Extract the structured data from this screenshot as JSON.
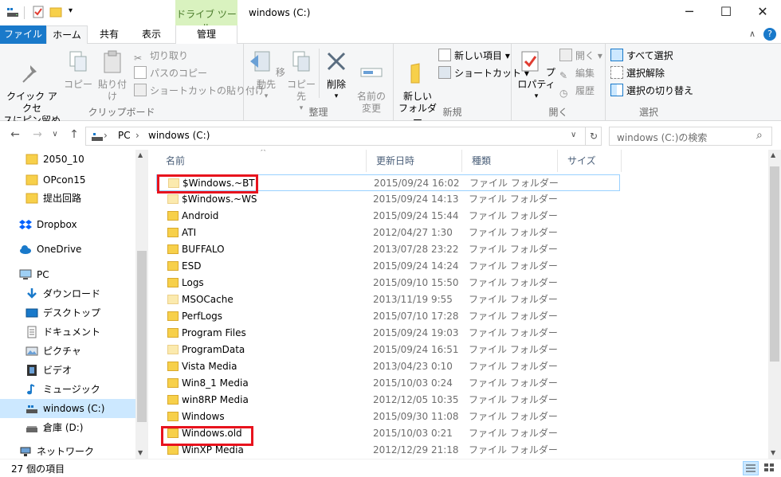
{
  "titlebar": {
    "context_tab": "ドライブ ツール",
    "title": "windows (C:)",
    "minimize": "─",
    "maximize": "☐",
    "close": "✕"
  },
  "tabs": {
    "file": "ファイル",
    "home": "ホーム",
    "share": "共有",
    "view": "表示",
    "manage": "管理",
    "collapse": "∧",
    "help": "?"
  },
  "ribbon": {
    "clipboard": {
      "label": "クリップボード",
      "pin": "クイック アクセ\nスにピン留め",
      "copy": "コピー",
      "paste": "貼り付け",
      "cut": "切り取り",
      "copy_path": "パスのコピー",
      "paste_shortcut": "ショートカットの貼り付け"
    },
    "organize": {
      "label": "整理",
      "move_to": "移動先",
      "copy_to": "コピー先",
      "delete": "削除",
      "rename": "名前の\n変更"
    },
    "new": {
      "label": "新規",
      "new_folder": "新しい\nフォルダー",
      "new_item": "新しい項目 ▾",
      "shortcut": "ショートカット ▾"
    },
    "open": {
      "label": "開く",
      "properties": "プロパティ",
      "open": "開く ▾",
      "edit": "編集",
      "history": "履歴"
    },
    "select": {
      "label": "選択",
      "select_all": "すべて選択",
      "select_none": "選択解除",
      "invert": "選択の切り替え"
    }
  },
  "address": {
    "back": "←",
    "forward": "→",
    "history": "∨",
    "up": "↑",
    "crumb_pc": "PC",
    "sep1": "›",
    "crumb_drive": "windows (C:)",
    "sep2": "›",
    "dropdown": "∨",
    "refresh": "↻",
    "search_placeholder": "windows (C:)の検索",
    "search_icon": "⌕"
  },
  "nav": {
    "items": [
      {
        "label": "2050_10"
      },
      {
        "label": "OPcon15"
      },
      {
        "label": "提出回路"
      },
      {
        "label": "Dropbox"
      },
      {
        "label": "OneDrive"
      },
      {
        "label": "PC"
      },
      {
        "label": "ダウンロード"
      },
      {
        "label": "デスクトップ"
      },
      {
        "label": "ドキュメント"
      },
      {
        "label": "ピクチャ"
      },
      {
        "label": "ビデオ"
      },
      {
        "label": "ミュージック"
      },
      {
        "label": "windows (C:)"
      },
      {
        "label": "倉庫 (D:)"
      },
      {
        "label": "ネットワーク"
      }
    ]
  },
  "filelist": {
    "sort_arrow": "^",
    "columns": {
      "name": "名前",
      "date": "更新日時",
      "type": "種類",
      "size": "サイズ"
    },
    "rows": [
      {
        "name": "$Windows.~BT",
        "date": "2015/09/24 16:02",
        "type": "ファイル フォルダー"
      },
      {
        "name": "$Windows.~WS",
        "date": "2015/09/24 14:13",
        "type": "ファイル フォルダー"
      },
      {
        "name": "Android",
        "date": "2015/09/24 15:44",
        "type": "ファイル フォルダー"
      },
      {
        "name": "ATI",
        "date": "2012/04/27 1:30",
        "type": "ファイル フォルダー"
      },
      {
        "name": "BUFFALO",
        "date": "2013/07/28 23:22",
        "type": "ファイル フォルダー"
      },
      {
        "name": "ESD",
        "date": "2015/09/24 14:24",
        "type": "ファイル フォルダー"
      },
      {
        "name": "Logs",
        "date": "2015/09/10 15:50",
        "type": "ファイル フォルダー"
      },
      {
        "name": "MSOCache",
        "date": "2013/11/19 9:55",
        "type": "ファイル フォルダー"
      },
      {
        "name": "PerfLogs",
        "date": "2015/07/10 17:28",
        "type": "ファイル フォルダー"
      },
      {
        "name": "Program Files",
        "date": "2015/09/24 19:03",
        "type": "ファイル フォルダー"
      },
      {
        "name": "ProgramData",
        "date": "2015/09/24 16:51",
        "type": "ファイル フォルダー"
      },
      {
        "name": "Vista Media",
        "date": "2013/04/23 0:10",
        "type": "ファイル フォルダー"
      },
      {
        "name": "Win8_1 Media",
        "date": "2015/10/03 0:24",
        "type": "ファイル フォルダー"
      },
      {
        "name": "win8RP Media",
        "date": "2012/12/05 10:35",
        "type": "ファイル フォルダー"
      },
      {
        "name": "Windows",
        "date": "2015/09/30 11:08",
        "type": "ファイル フォルダー"
      },
      {
        "name": "Windows.old",
        "date": "2015/10/03 0:21",
        "type": "ファイル フォルダー"
      },
      {
        "name": "WinXP Media",
        "date": "2012/12/29 21:18",
        "type": "ファイル フォルダー"
      }
    ]
  },
  "status": {
    "item_count": "27 個の項目"
  },
  "colors": {
    "accent": "#1979ca",
    "context_tab": "#d9f2bf",
    "highlight": "#e8131d",
    "selection": "#cce8ff",
    "folder": "#f7d04a"
  }
}
